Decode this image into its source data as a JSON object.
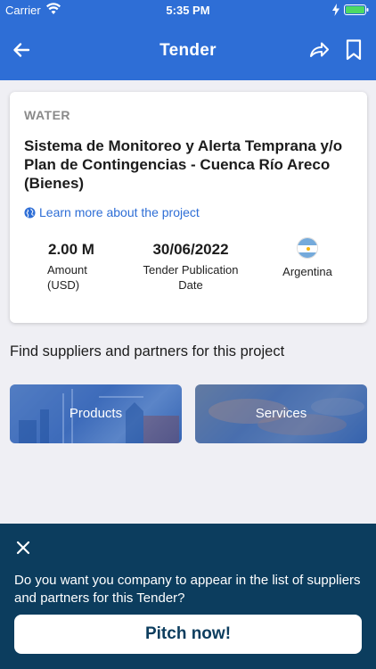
{
  "status_bar": {
    "carrier": "Carrier",
    "time": "5:35 PM"
  },
  "nav": {
    "title": "Tender",
    "icons": [
      "back-arrow-icon",
      "share-icon",
      "bookmark-icon"
    ]
  },
  "tender": {
    "category": "WATER",
    "title": "Sistema de Monitoreo y Alerta Temprana y/o Plan de Contingencias - Cuenca Río Areco (Bienes)",
    "learn_more": "Learn more about the project",
    "amount": {
      "value": "2.00 M",
      "label": "Amount (USD)"
    },
    "date": {
      "value": "30/06/2022",
      "label": "Tender Publication Date"
    },
    "country": {
      "label": "Argentina",
      "icon": "argentina-flag-icon"
    }
  },
  "suppliers": {
    "heading": "Find suppliers and partners for this project",
    "products_label": "Products",
    "services_label": "Services"
  },
  "banner": {
    "question": "Do you want you company to appear in the list of suppliers and partners for this Tender?",
    "cta": "Pitch now!"
  },
  "colors": {
    "primary": "#2e6ed6",
    "banner": "#0c3d5e",
    "background": "#efeff4",
    "category_gray": "#8a8a8a"
  }
}
